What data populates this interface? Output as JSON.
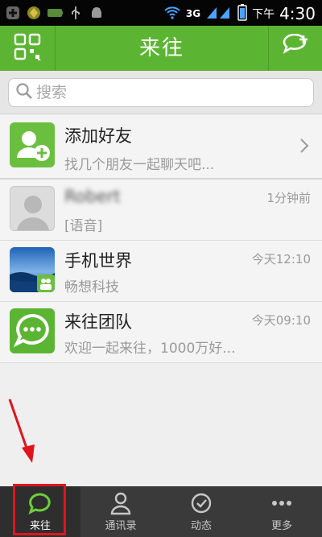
{
  "status_bar": {
    "network": "3G",
    "ampm": "下午",
    "time": "4:30"
  },
  "title_bar": {
    "title": "来往"
  },
  "search": {
    "placeholder": "搜索"
  },
  "rows": [
    {
      "name": "添加好友",
      "subtitle": "找几个朋友一起聊天吧...",
      "time": ""
    },
    {
      "name": "Robert",
      "subtitle": "[语音]",
      "time": "1分钟前"
    },
    {
      "name": "手机世界",
      "subtitle": "畅想科技",
      "time": "今天12:10"
    },
    {
      "name": "来往团队",
      "subtitle": "欢迎一起来往，1000万好...",
      "time": "今天09:10"
    }
  ],
  "tabs": [
    {
      "label": "来往"
    },
    {
      "label": "通讯录"
    },
    {
      "label": "动态"
    },
    {
      "label": "更多"
    }
  ],
  "colors": {
    "brand_green": "#5cb532",
    "tab_bar": "#3a3a3a",
    "annotation_red": "#e0151c"
  }
}
